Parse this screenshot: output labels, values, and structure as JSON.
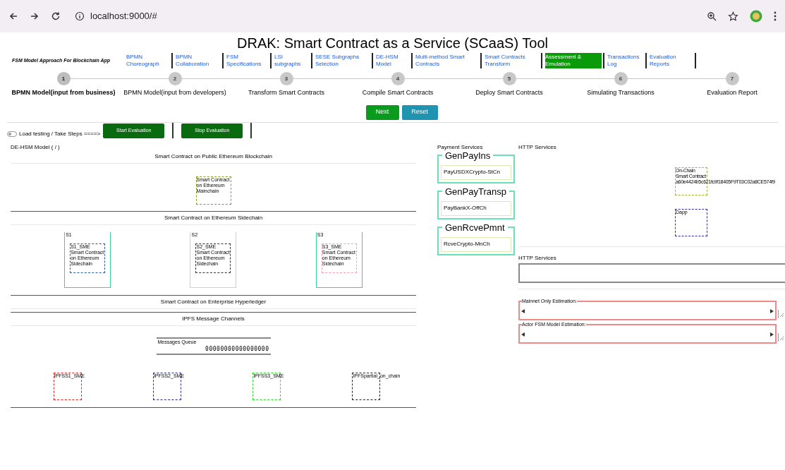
{
  "browser": {
    "url": "localhost:9000/#"
  },
  "title": "DRAK: Smart Contract as a Service (SCaaS) Tool",
  "nav": {
    "brand": "FSM Model Approach For Blockchain App",
    "links": [
      {
        "label": "BPMN Choreograph",
        "selected": false
      },
      {
        "label": "BPMN Collaboration",
        "selected": false
      },
      {
        "label": "FSM Specifications",
        "selected": false
      },
      {
        "label": "LSI subgraphs",
        "selected": false
      },
      {
        "label": "SESE Subgraphs Selection",
        "selected": false
      },
      {
        "label": "DE-HSM Model",
        "selected": false
      },
      {
        "label": "Multi-method Smart Contracts",
        "selected": false
      },
      {
        "label": "Smart Contracts Transform",
        "selected": false
      },
      {
        "label": "Assessment & Emulation",
        "selected": true
      },
      {
        "label": "Transactions Log",
        "selected": false
      },
      {
        "label": "Evaluation Reports",
        "selected": false
      }
    ]
  },
  "steps": [
    {
      "number": "1",
      "label": "BPMN Model(input from business)",
      "selected": true
    },
    {
      "number": "2",
      "label": "BPMN Model(input from developers)",
      "selected": false
    },
    {
      "number": "3",
      "label": "Transform Smart Contracts",
      "selected": false
    },
    {
      "number": "4",
      "label": "Compile Smart Contracts",
      "selected": false
    },
    {
      "number": "5",
      "label": "Deploy Smart Contracts",
      "selected": false
    },
    {
      "number": "6",
      "label": "Simulating Transactions",
      "selected": false
    },
    {
      "number": "7",
      "label": "Evaluation Report",
      "selected": false
    }
  ],
  "step_buttons": [
    "Next",
    "Reset"
  ],
  "toolbar": {
    "toggle": {
      "label": "Load testing / Take Steps ====>",
      "on": false
    },
    "buttons": [
      "Start Evaluation",
      "Stop Evaluation"
    ]
  },
  "model": {
    "title": "DE-HSM Model ( / )",
    "sections": [
      {
        "kind": "mainchain",
        "title": "Smart Contract on Public Ethereum Blockchain",
        "box": {
          "label": "Smart Contract on Ethereum Mainchain",
          "color": "#8a9a1a"
        }
      },
      {
        "kind": "sidechains",
        "title": "Smart Contract on Ethereum Sidechain",
        "sidechains": [
          {
            "name": "S1",
            "highlighted": true,
            "box": {
              "label": "S1_SME Smart Contract on Ethereum Sidechain",
              "color": "#2a5aa0"
            }
          },
          {
            "name": "S2",
            "highlighted": false,
            "box": {
              "label": "S2_SME Smart Contract on Ethereum Sidechain",
              "color": "#333333"
            }
          },
          {
            "name": "S3",
            "highlighted": true,
            "box": {
              "label": "S3_SME Smart Contract on Ethereum Sidechain",
              "color": "#f4a0b0"
            }
          }
        ]
      },
      {
        "kind": "empty",
        "title": "Smart Contract on Enterprise Hyperledger"
      },
      {
        "kind": "ipfs",
        "title": "IPFS Message Channels",
        "queue": {
          "label": "Messages Queue",
          "value": "00000000000000000"
        },
        "channels": [
          {
            "label": "IPFSS1_SME",
            "color": "#e02020"
          },
          {
            "label": "IPFSS2_SME",
            "color": "#2a2a80"
          },
          {
            "label": "IPFSS3_SME",
            "color": "#20e020"
          },
          {
            "label": "IPFSpartial_on_chain",
            "color": "#222222"
          }
        ]
      }
    ]
  },
  "payment_services": {
    "title": "Payment Services",
    "cards": [
      {
        "title": "GenPayIns",
        "value": "PayUSDXCrypto-StCn"
      },
      {
        "title": "GenPayTransp",
        "value": "PayBankX-OffCh"
      },
      {
        "title": "GenRcvePmnt",
        "value": "RcveCrypto-MnCh"
      }
    ]
  },
  "http_services": {
    "title": "HTTP Services",
    "onchain": {
      "lines": [
        "On-Chain",
        "Smart Contract",
        "a60e4424b5c621fc9f18405F9T03C02a8CE574f9"
      ],
      "color": "#9ab82a"
    },
    "dapp": {
      "label": "Dapp",
      "color": "#3030a0"
    }
  },
  "http_field": {
    "label": "HTTP Services"
  },
  "estimations": [
    "Mainnet Only Estimation:",
    "Actor FSM Model Estimation:"
  ]
}
